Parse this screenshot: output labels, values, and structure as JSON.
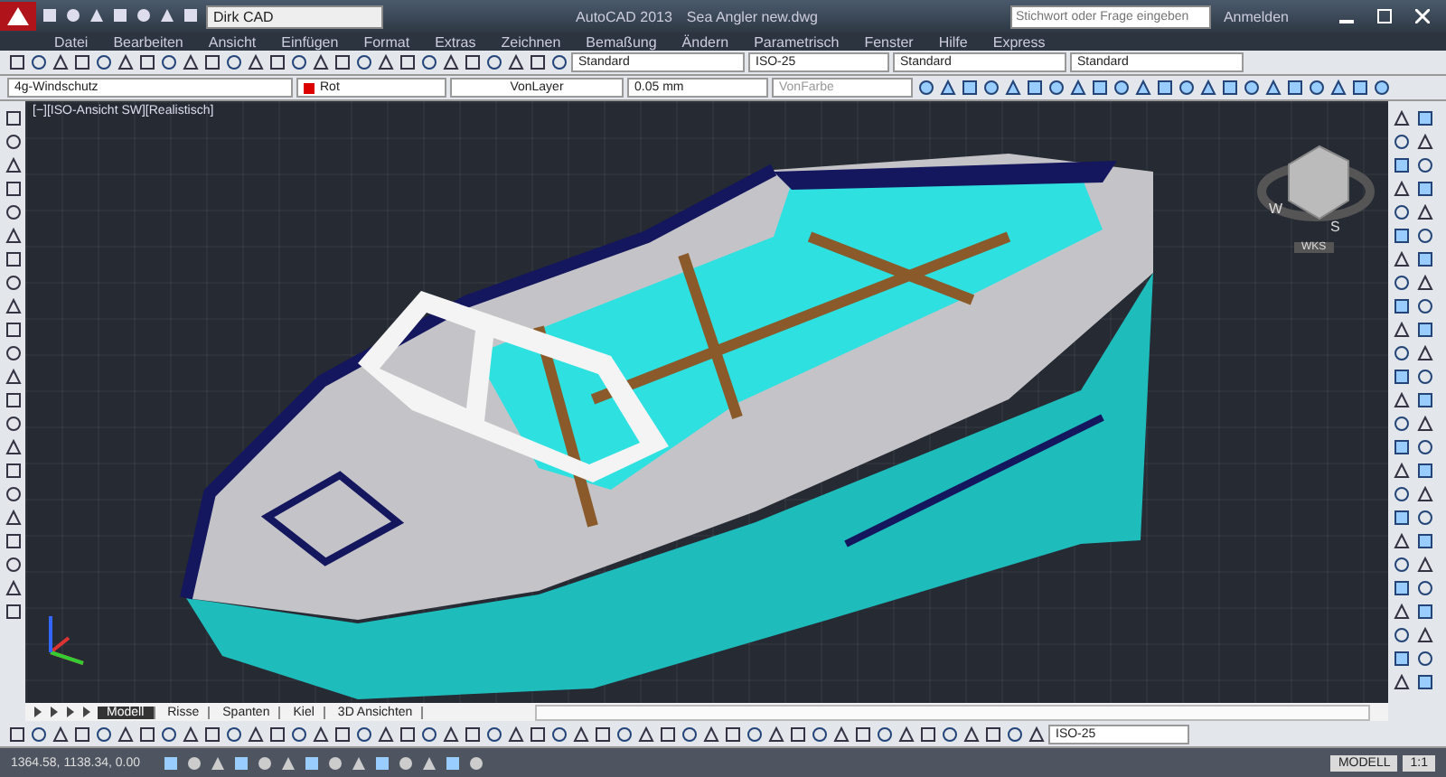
{
  "title_bar": {
    "workspace": "Dirk CAD",
    "app_title": "AutoCAD 2013",
    "file_name": "Sea Angler new.dwg",
    "search": {
      "placeholder": "Stichwort oder Frage eingeben"
    },
    "sign_in": "Anmelden"
  },
  "menu": [
    "Datei",
    "Bearbeiten",
    "Ansicht",
    "Einfügen",
    "Format",
    "Extras",
    "Zeichnen",
    "Bemaßung",
    "Ändern",
    "Parametrisch",
    "Fenster",
    "Hilfe",
    "Express"
  ],
  "styles_toolbar": {
    "text_style": "Standard",
    "dim_style": "ISO-25",
    "table_style": "Standard",
    "mleader_style": "Standard"
  },
  "properties_toolbar": {
    "layer": "4g-Windschutz",
    "color_name": "Rot",
    "linetype": "VonLayer",
    "lineweight": "0.05 mm",
    "plot_style": "VonFarbe"
  },
  "viewport": {
    "label": "[−][ISO-Ansicht SW][Realistisch]",
    "compass": [
      "W",
      "S"
    ],
    "ucs": "WKS"
  },
  "layout_tabs": [
    {
      "label": "Modell",
      "selected": true
    },
    {
      "label": "Risse",
      "selected": false
    },
    {
      "label": "Spanten",
      "selected": false
    },
    {
      "label": "Kiel",
      "selected": false
    },
    {
      "label": "3D Ansichten",
      "selected": false
    }
  ],
  "dim_toolbar": {
    "dim_style": "ISO-25"
  },
  "status_bar": {
    "coordinates": "1364.58, 1138.34, 0.00",
    "space": "MODELL",
    "scale": "1:1"
  }
}
